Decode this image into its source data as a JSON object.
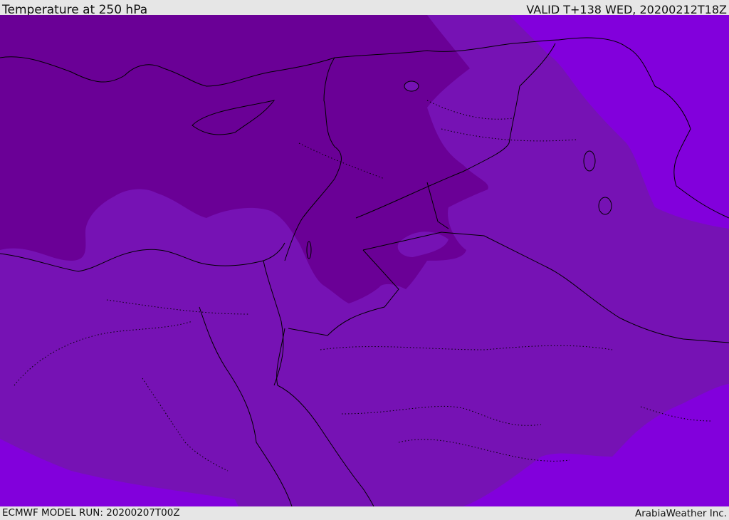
{
  "header": {
    "title": "Temperature at 250 hPa",
    "valid": "VALID T+138 WED, 20200212T18Z"
  },
  "footer": {
    "model_run": "ECMWF MODEL RUN: 20200207T00Z",
    "brand": "ArabiaWeather Inc."
  },
  "colors": {
    "deep_purple": "#6a0096",
    "mid_purple": "#7612b4",
    "violet": "#8200dc",
    "coastline": "#000000"
  }
}
